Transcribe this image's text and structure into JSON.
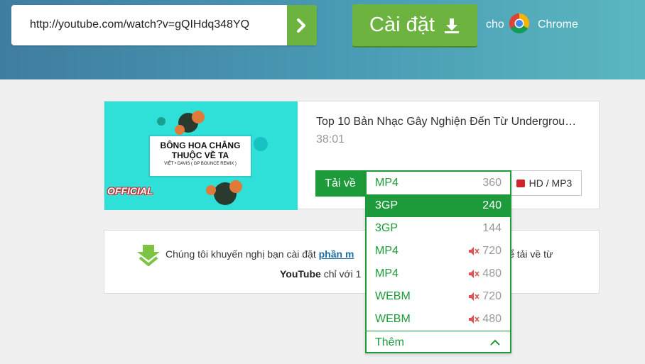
{
  "header": {
    "url_value": "http://youtube.com/watch?v=gQIHdq348YQ",
    "install_label": "Cài đặt",
    "for_label": "cho",
    "browser_name": "Chrome"
  },
  "video": {
    "title": "Top 10 Bản Nhạc Gây Nghiện Đến Từ Undergrou…",
    "duration": "38:01",
    "thumbnail_title_1": "BÔNG HOA CHẲNG",
    "thumbnail_title_2": "THUỘC VỀ TA",
    "thumbnail_credit": "VIỆT • DAVIS ( GP BOUNCE REMIX )",
    "thumbnail_badge": "OFFICIAL",
    "download_label": "Tải về",
    "hd_label": "HD / MP3"
  },
  "recommend": {
    "line1_before": "Chúng tôi khuyến nghị bạn cài đặt ",
    "line1_link": "phần m",
    "line1_after": "để tải về từ",
    "line2_bold": "YouTube",
    "line2_rest": " chỉ với 1"
  },
  "formats": [
    {
      "format": "MP4",
      "quality": "360",
      "muted": false,
      "selected": false
    },
    {
      "format": "3GP",
      "quality": "240",
      "muted": false,
      "selected": true
    },
    {
      "format": "3GP",
      "quality": "144",
      "muted": false,
      "selected": false
    },
    {
      "format": "MP4",
      "quality": "720",
      "muted": true,
      "selected": false
    },
    {
      "format": "MP4",
      "quality": "480",
      "muted": true,
      "selected": false
    },
    {
      "format": "WEBM",
      "quality": "720",
      "muted": true,
      "selected": false
    },
    {
      "format": "WEBM",
      "quality": "480",
      "muted": true,
      "selected": false
    }
  ],
  "more_label": "Thêm",
  "colors": {
    "green": "#1d9b3a",
    "install_green": "#6db33f",
    "mute_red": "#e05050"
  }
}
